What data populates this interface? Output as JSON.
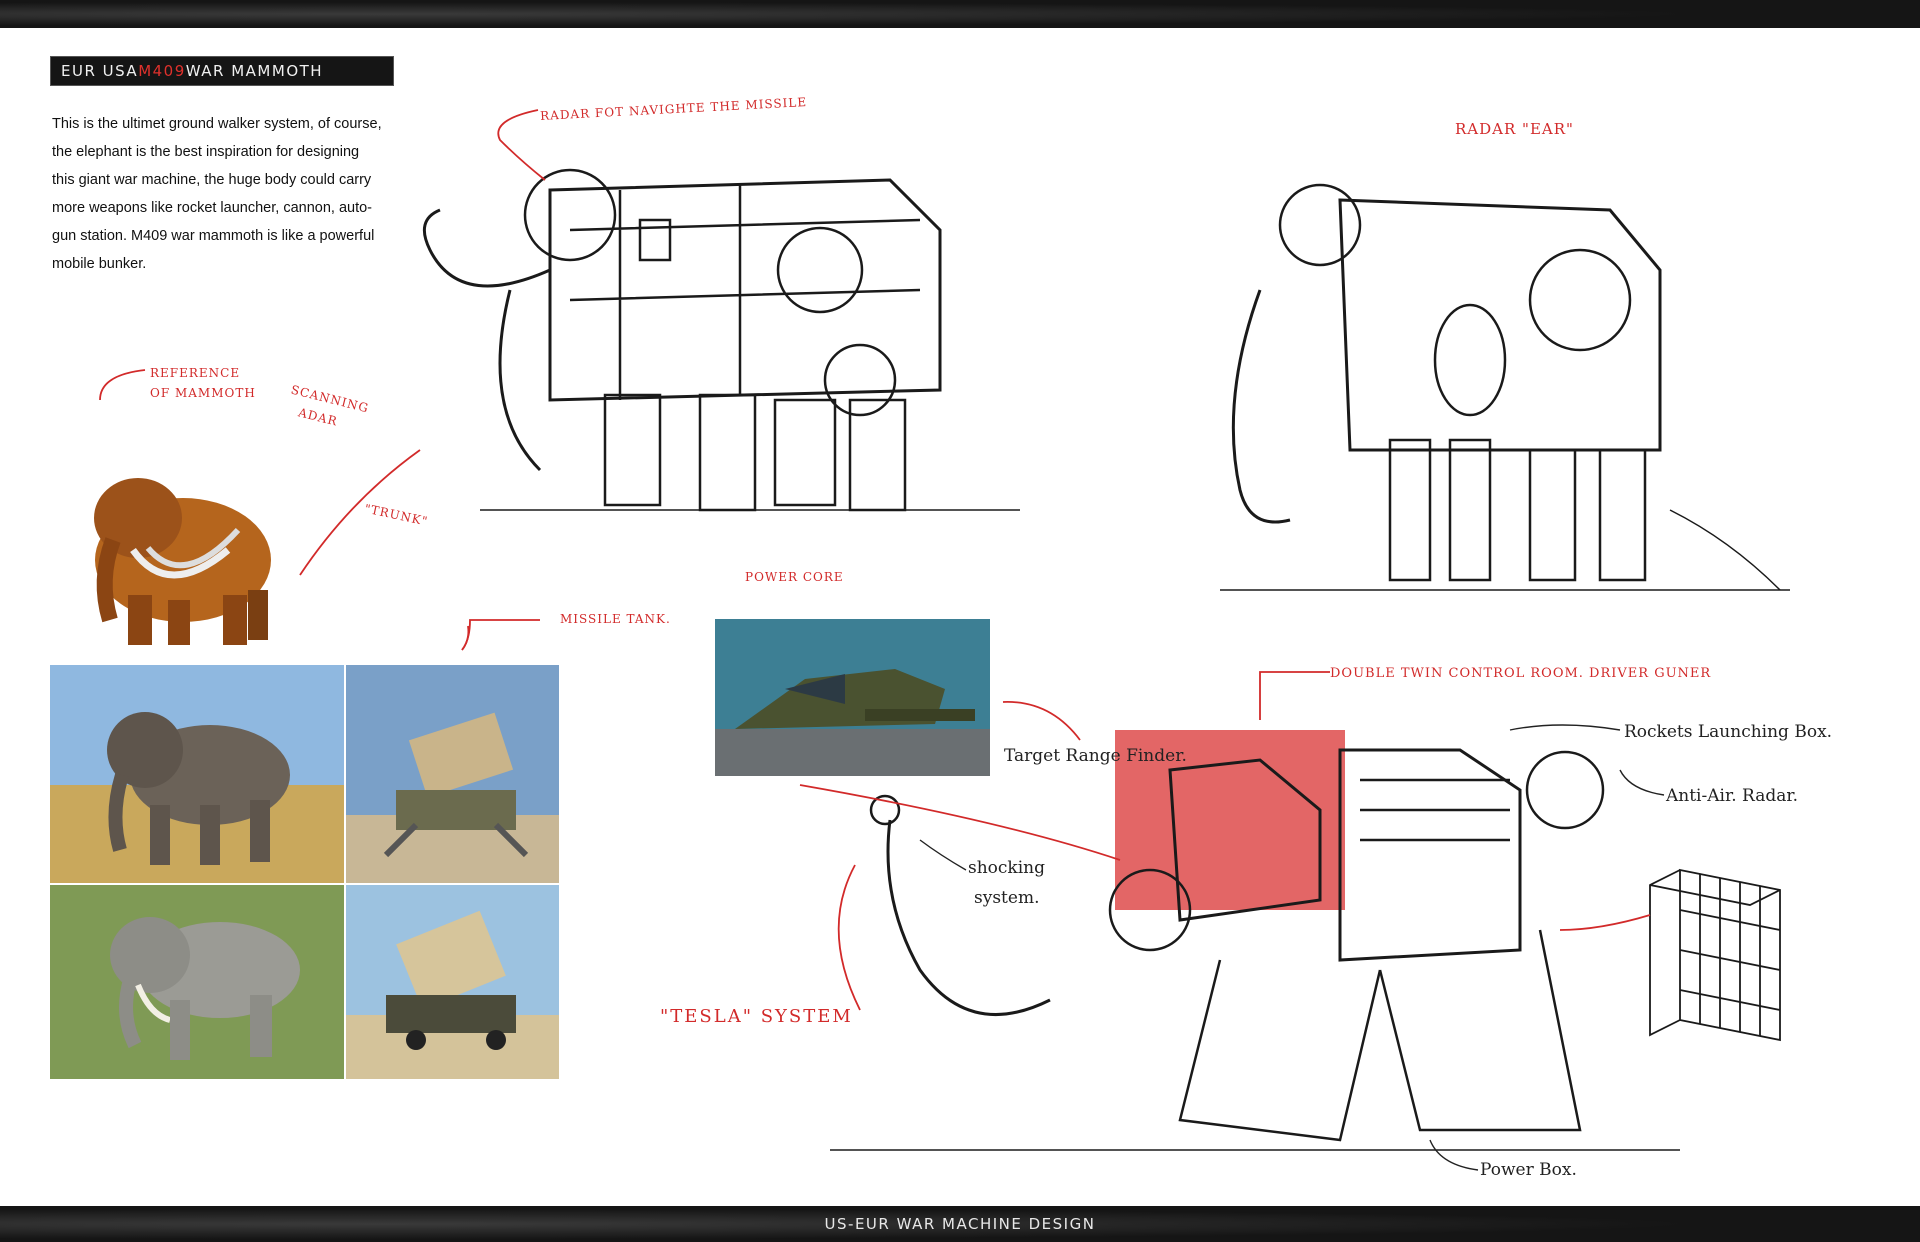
{
  "title": {
    "pre": "EUR USA ",
    "accent": "M409",
    "post": " WAR MAMMOTH"
  },
  "intro_text": "This is the ultimet ground walker system, of course, the elephant is the best inspiration for designing this giant war machine, the huge body could carry more weapons like rocket launcher, cannon, auto-gun station. M409 war mammoth is like a powerful mobile bunker.",
  "notes": {
    "radar_missile": "RADAR FOT NAVIGHTE THE MISSILE",
    "reference_line1": "REFERENCE",
    "reference_line2": "OF MAMMOTH",
    "scanning_line1": "SCANNING",
    "scanning_line2": "ADAR",
    "trunk": "\"TRUNK\"",
    "power_core": "POWER CORE",
    "radar_ear": "RADAR \"EAR\"",
    "missile_tank": "MISSILE TANK.",
    "control_room": "DOUBLE TWIN CONTROL ROOM. DRIVER GUNER",
    "target_range": "Target Range Finder.",
    "rockets_box": "Rockets Launching Box.",
    "anti_air": "Anti-Air. Radar.",
    "shocking_line1": "shocking",
    "shocking_line2": "system.",
    "tesla": "\"TESLA\" SYSTEM",
    "power_box": "Power Box."
  },
  "footer": "US-EUR WAR MACHINE DESIGN",
  "colors": {
    "accent": "#d22a2a",
    "band": "#1c1c1c"
  }
}
